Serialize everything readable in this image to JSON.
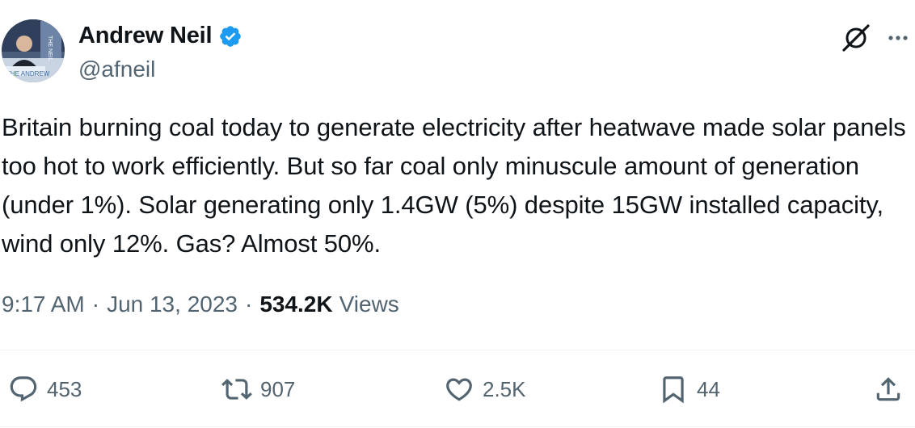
{
  "author": {
    "name": "Andrew Neil",
    "handle": "@afneil",
    "verified": true,
    "avatar_label_top": "THE NEIL",
    "avatar_label_bottom": "THE ANDREW"
  },
  "tweet": {
    "text": "Britain burning coal today to generate electricity after heatwave made solar panels too hot to work efficiently. But so far coal only minuscule amount of generation (under 1%). Solar generating only 1.4GW (5%) despite 15GW installed capacity, wind only 12%. Gas? Almost 50%."
  },
  "meta": {
    "time": "9:17 AM",
    "separator": "·",
    "date": "Jun 13, 2023",
    "views_count": "534.2K",
    "views_label": "Views"
  },
  "actions": {
    "replies": "453",
    "reposts": "907",
    "likes": "2.5K",
    "bookmarks": "44"
  },
  "icons": {
    "verified": "verified-badge-icon",
    "grok": "grok-icon",
    "more": "more-icon",
    "reply": "reply-icon",
    "repost": "repost-icon",
    "like": "heart-icon",
    "bookmark": "bookmark-icon",
    "share": "share-icon"
  },
  "colors": {
    "text": "#0f1419",
    "secondary": "#536471",
    "verified": "#1d9bf0",
    "divider": "#eff3f4"
  }
}
